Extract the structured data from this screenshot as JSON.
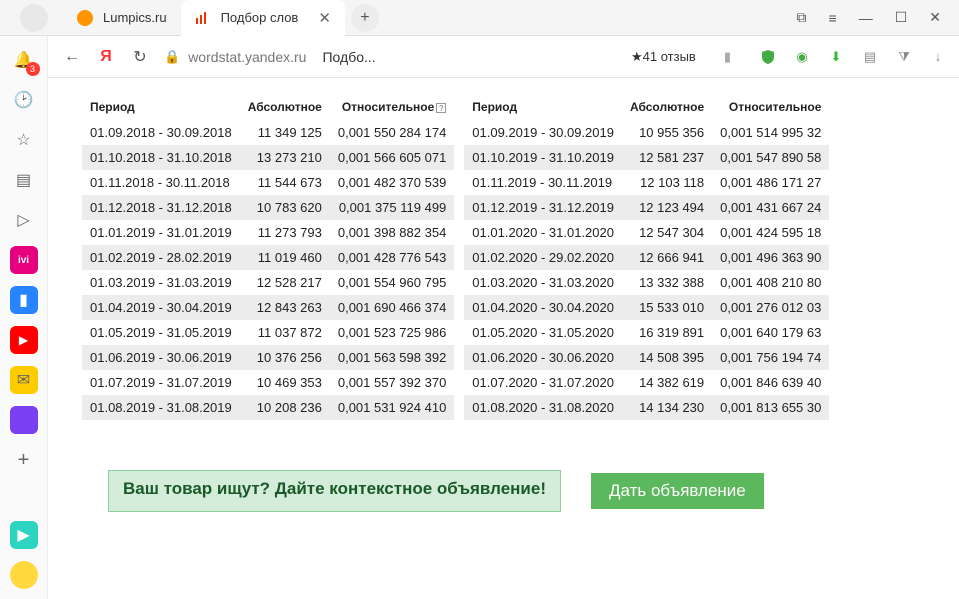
{
  "tabs": [
    {
      "label": "Lumpics.ru"
    },
    {
      "label": "Подбор слов"
    }
  ],
  "sidebar_badge": "3",
  "toolbar": {
    "url_host": "wordstat.yandex.ru",
    "url_title": "Подбо...",
    "reviews": "★41 отзыв"
  },
  "table_headers": {
    "period": "Период",
    "absolute": "Абсолютное",
    "relative": "Относительное"
  },
  "left_rows": [
    {
      "period": "01.09.2018 - 30.09.2018",
      "abs": "11 349 125",
      "rel": "0,001 550 284 174"
    },
    {
      "period": "01.10.2018 - 31.10.2018",
      "abs": "13 273 210",
      "rel": "0,001 566 605 071"
    },
    {
      "period": "01.11.2018 - 30.11.2018",
      "abs": "11 544 673",
      "rel": "0,001 482 370 539"
    },
    {
      "period": "01.12.2018 - 31.12.2018",
      "abs": "10 783 620",
      "rel": "0,001 375 119 499"
    },
    {
      "period": "01.01.2019 - 31.01.2019",
      "abs": "11 273 793",
      "rel": "0,001 398 882 354"
    },
    {
      "period": "01.02.2019 - 28.02.2019",
      "abs": "11 019 460",
      "rel": "0,001 428 776 543"
    },
    {
      "period": "01.03.2019 - 31.03.2019",
      "abs": "12 528 217",
      "rel": "0,001 554 960 795"
    },
    {
      "period": "01.04.2019 - 30.04.2019",
      "abs": "12 843 263",
      "rel": "0,001 690 466 374"
    },
    {
      "period": "01.05.2019 - 31.05.2019",
      "abs": "11 037 872",
      "rel": "0,001 523 725 986"
    },
    {
      "period": "01.06.2019 - 30.06.2019",
      "abs": "10 376 256",
      "rel": "0,001 563 598 392"
    },
    {
      "period": "01.07.2019 - 31.07.2019",
      "abs": "10 469 353",
      "rel": "0,001 557 392 370"
    },
    {
      "period": "01.08.2019 - 31.08.2019",
      "abs": "10 208 236",
      "rel": "0,001 531 924 410"
    }
  ],
  "right_rows": [
    {
      "period": "01.09.2019 - 30.09.2019",
      "abs": "10 955 356",
      "rel": "0,001 514 995 32"
    },
    {
      "period": "01.10.2019 - 31.10.2019",
      "abs": "12 581 237",
      "rel": "0,001 547 890 58"
    },
    {
      "period": "01.11.2019 - 30.11.2019",
      "abs": "12 103 118",
      "rel": "0,001 486 171 27"
    },
    {
      "period": "01.12.2019 - 31.12.2019",
      "abs": "12 123 494",
      "rel": "0,001 431 667 24"
    },
    {
      "period": "01.01.2020 - 31.01.2020",
      "abs": "12 547 304",
      "rel": "0,001 424 595 18"
    },
    {
      "period": "01.02.2020 - 29.02.2020",
      "abs": "12 666 941",
      "rel": "0,001 496 363 90"
    },
    {
      "period": "01.03.2020 - 31.03.2020",
      "abs": "13 332 388",
      "rel": "0,001 408 210 80"
    },
    {
      "period": "01.04.2020 - 30.04.2020",
      "abs": "15 533 010",
      "rel": "0,001 276 012 03"
    },
    {
      "period": "01.05.2020 - 31.05.2020",
      "abs": "16 319 891",
      "rel": "0,001 640 179 63"
    },
    {
      "period": "01.06.2020 - 30.06.2020",
      "abs": "14 508 395",
      "rel": "0,001 756 194 74"
    },
    {
      "period": "01.07.2020 - 31.07.2020",
      "abs": "14 382 619",
      "rel": "0,001 846 639 40"
    },
    {
      "period": "01.08.2020 - 31.08.2020",
      "abs": "14 134 230",
      "rel": "0,001 813 655 30"
    }
  ],
  "banner": {
    "title": "Ваш товар ищут? Дайте контекстное объявление!",
    "button": "Дать объявление"
  }
}
